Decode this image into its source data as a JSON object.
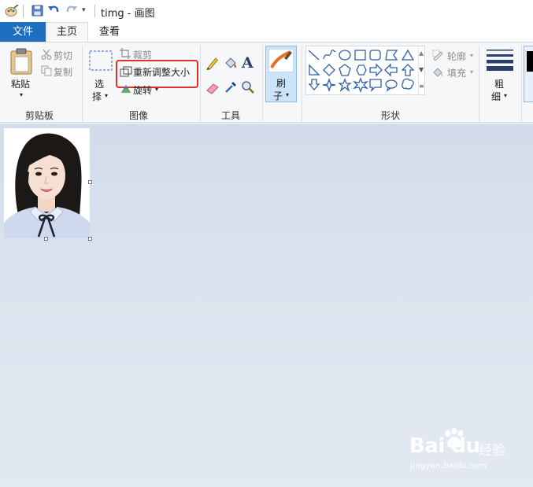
{
  "window": {
    "title": "timg - 画图",
    "quick_access_arrow": "▾"
  },
  "tabs": {
    "file": "文件",
    "home": "主页",
    "view": "查看"
  },
  "ribbon": {
    "clipboard": {
      "paste": "粘贴",
      "cut": "剪切",
      "copy": "复制",
      "group_label": "剪贴板"
    },
    "image": {
      "select_line1": "选",
      "select_line2": "择",
      "crop": "裁剪",
      "resize": "重新调整大小",
      "rotate": "旋转",
      "group_label": "图像"
    },
    "tools": {
      "group_label": "工具"
    },
    "brushes": {
      "line1": "刷",
      "line2": "子"
    },
    "shapes": {
      "outline": "轮廓",
      "fill": "填充",
      "group_label": "形状"
    },
    "size": {
      "line1": "粗",
      "line2": "细"
    }
  },
  "watermark": {
    "logo": "Bai du",
    "brand": "经验",
    "url": "jingyan.baidu.com"
  },
  "colors": {
    "file_tab": "#1e6fc0",
    "highlight_box": "#e0302c",
    "workspace": "#d2dcea",
    "brush_active": "#cde3f7"
  }
}
